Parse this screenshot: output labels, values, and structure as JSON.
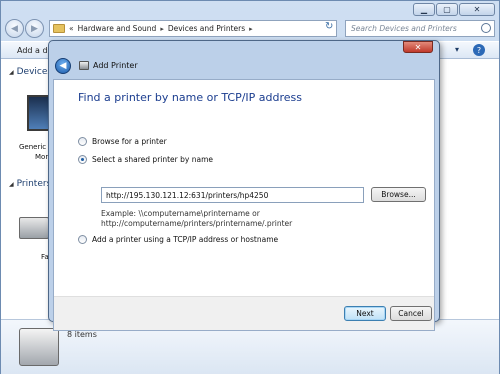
{
  "explorer": {
    "breadcrumb": {
      "overflow": "«",
      "items": [
        "Hardware and Sound",
        "Devices and Printers"
      ]
    },
    "search_placeholder": "Search Devices and Printers",
    "cmd_add_device": "Add a de",
    "groups": {
      "devices": "Devices",
      "printers": "Printers"
    },
    "device_label_1": "Generic N",
    "device_label_2": "Mon",
    "printer_label": "Fa",
    "details_count": "8 items"
  },
  "dialog": {
    "title": "Add Printer",
    "heading": "Find a printer by name or TCP/IP address",
    "options": {
      "browse": "Browse for a printer",
      "shared": "Select a shared printer by name",
      "tcpip": "Add a printer using a TCP/IP address or hostname"
    },
    "selected_option": "shared",
    "url_value": "http://195.130.121.12:631/printers/hp4250",
    "browse_button": "Browse...",
    "example_line1": "Example: \\\\computername\\printername or",
    "example_line2": "http://computername/printers/printername/.printer",
    "next_button": "Next",
    "cancel_button": "Cancel"
  }
}
